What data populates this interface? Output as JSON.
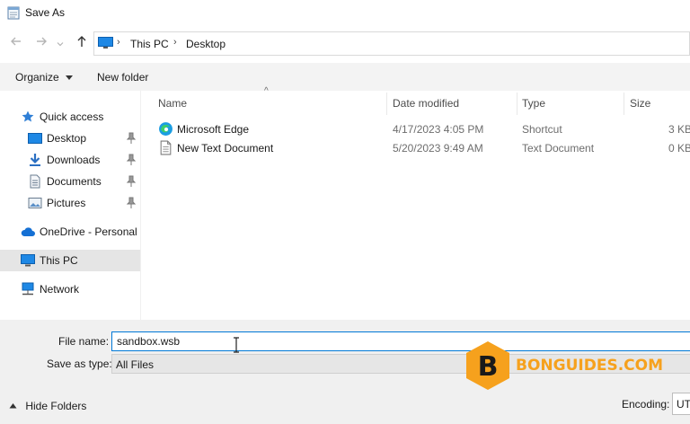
{
  "window": {
    "title": "Save As",
    "title_icon": "notepad-icon"
  },
  "address_bar": {
    "back_icon": "arrow-left-icon",
    "forward_icon": "arrow-right-icon",
    "recent_icon": "chevron-down-icon",
    "up_icon": "arrow-up-icon",
    "breadcrumbs": [
      "This PC",
      "Desktop"
    ]
  },
  "toolbar": {
    "organize_label": "Organize",
    "new_folder_label": "New folder"
  },
  "nav_pane": {
    "items": [
      {
        "label": "Quick access",
        "icon": "star-icon"
      },
      {
        "label": "Desktop",
        "icon": "desktop-folder-icon",
        "pinned": true
      },
      {
        "label": "Downloads",
        "icon": "download-icon",
        "pinned": true
      },
      {
        "label": "Documents",
        "icon": "documents-icon",
        "pinned": true
      },
      {
        "label": "Pictures",
        "icon": "pictures-icon",
        "pinned": true
      },
      {
        "label": "OneDrive - Personal",
        "icon": "cloud-icon"
      },
      {
        "label": "This PC",
        "icon": "computer-icon",
        "selected": true
      },
      {
        "label": "Network",
        "icon": "network-icon"
      }
    ]
  },
  "file_list": {
    "columns": [
      "Name",
      "Date modified",
      "Type",
      "Size"
    ],
    "rows": [
      {
        "name": "Microsoft Edge",
        "date": "4/17/2023 4:05 PM",
        "type": "Shortcut",
        "size": "3 KB",
        "icon": "edge-icon"
      },
      {
        "name": "New Text Document",
        "date": "5/20/2023 9:49 AM",
        "type": "Text Document",
        "size": "0 KB",
        "icon": "text-file-icon"
      }
    ]
  },
  "save_panel": {
    "file_name_label": "File name:",
    "file_name_value": "sandbox.wsb",
    "save_as_type_label": "Save as type:",
    "save_as_type_value": "All Files",
    "hide_folders_label": "Hide Folders",
    "encoding_label": "Encoding:",
    "encoding_value": "UT"
  },
  "watermark": {
    "letter": "B",
    "text": "BONGUIDES.COM",
    "color": "#f6a11d"
  },
  "colors": {
    "accent": "#0078d7",
    "selected_bg": "#e5e5e5",
    "toolbar_bg": "#f3f3f3",
    "panel_bg": "#f0f0f0"
  }
}
